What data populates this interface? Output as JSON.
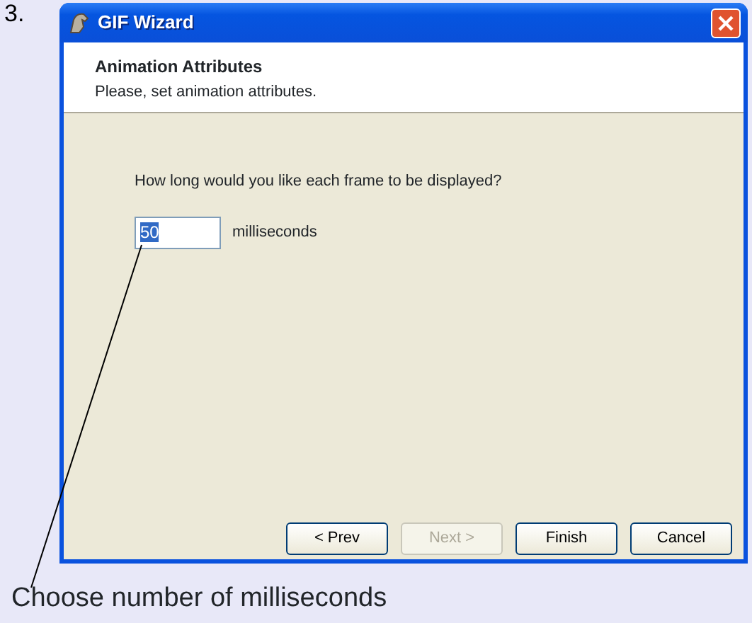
{
  "step_label": "3.",
  "window": {
    "title": "GIF Wizard"
  },
  "header": {
    "title": "Animation Attributes",
    "subtitle": "Please, set animation attributes."
  },
  "question": "How long would you like each frame to be displayed?",
  "duration_field": {
    "value": "50",
    "text_selected": true,
    "unit": "milliseconds"
  },
  "buttons": [
    {
      "label": "< Prev",
      "disabled": false
    },
    {
      "label": "Next >",
      "disabled": true
    },
    {
      "label": "Finish",
      "disabled": false
    },
    {
      "label": "Cancel",
      "disabled": false
    }
  ],
  "caption": "Choose number of milliseconds"
}
